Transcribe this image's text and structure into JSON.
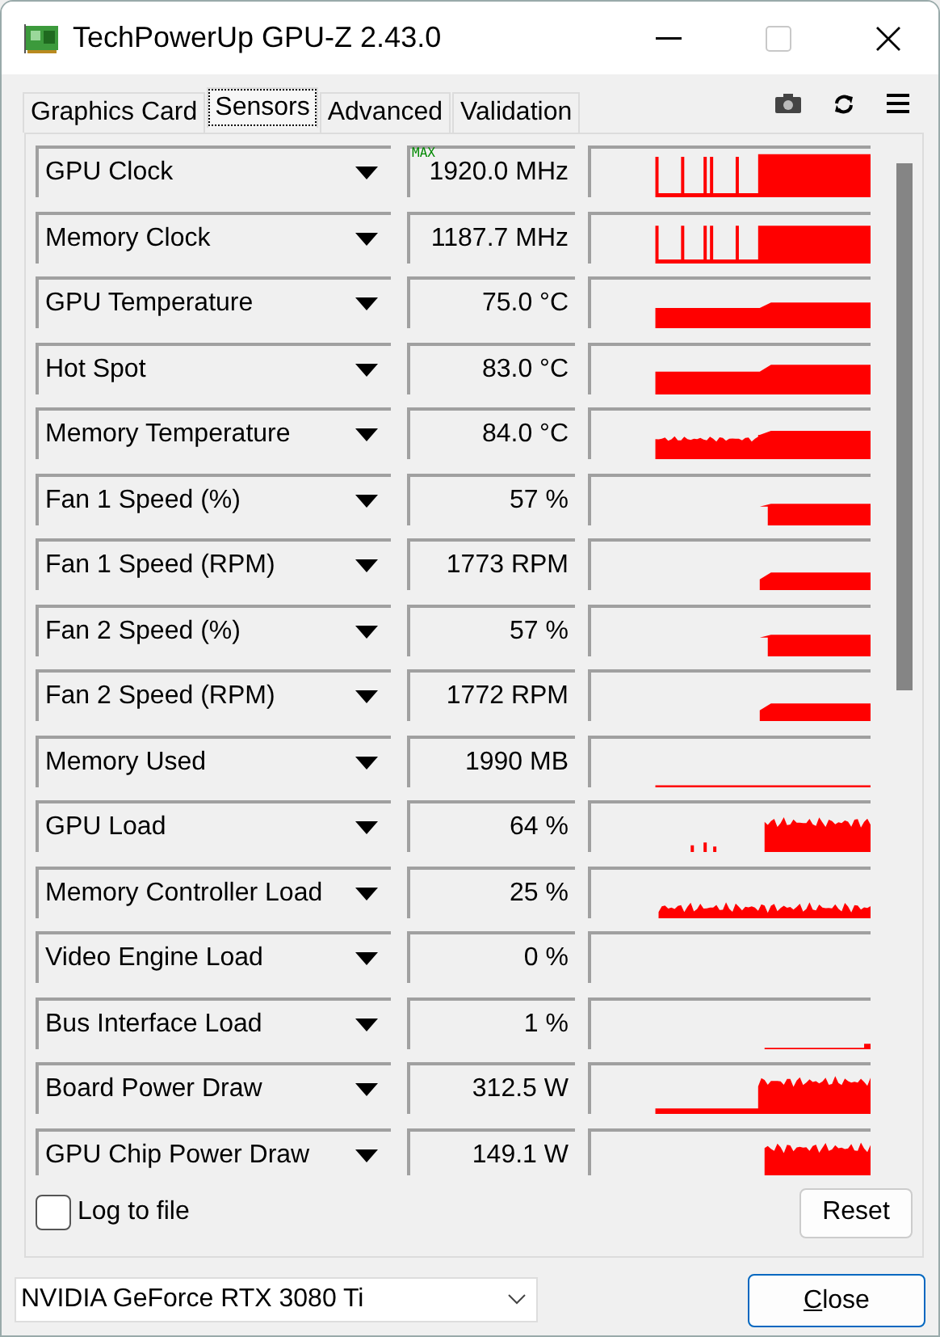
{
  "window": {
    "title": "TechPowerUp GPU-Z 2.43.0"
  },
  "tabs": [
    {
      "label": "Graphics Card",
      "selected": false
    },
    {
      "label": "Sensors",
      "selected": true
    },
    {
      "label": "Advanced",
      "selected": false
    },
    {
      "label": "Validation",
      "selected": false
    }
  ],
  "sensors": [
    {
      "name": "GPU Clock",
      "value": "1920.0 MHz",
      "value_tag": "MAX"
    },
    {
      "name": "Memory Clock",
      "value": "1187.7 MHz"
    },
    {
      "name": "GPU Temperature",
      "value": "75.0 °C"
    },
    {
      "name": "Hot Spot",
      "value": "83.0 °C"
    },
    {
      "name": "Memory Temperature",
      "value": "84.0 °C"
    },
    {
      "name": "Fan 1 Speed (%)",
      "value": "57 %"
    },
    {
      "name": "Fan 1 Speed (RPM)",
      "value": "1773 RPM"
    },
    {
      "name": "Fan 2 Speed (%)",
      "value": "57 %"
    },
    {
      "name": "Fan 2 Speed (RPM)",
      "value": "1772 RPM"
    },
    {
      "name": "Memory Used",
      "value": "1990 MB"
    },
    {
      "name": "GPU Load",
      "value": "64 %"
    },
    {
      "name": "Memory Controller Load",
      "value": "25 %"
    },
    {
      "name": "Video Engine Load",
      "value": "0 %"
    },
    {
      "name": "Bus Interface Load",
      "value": "1 %"
    },
    {
      "name": "Board Power Draw",
      "value": "312.5 W"
    },
    {
      "name": "GPU Chip Power Draw",
      "value": "149.1 W"
    }
  ],
  "log_to_file": {
    "label": "Log to file",
    "checked": false
  },
  "reset_button": "Reset",
  "gpu_select": {
    "value": "NVIDIA GeForce RTX 3080 Ti"
  },
  "close_button": "Close"
}
